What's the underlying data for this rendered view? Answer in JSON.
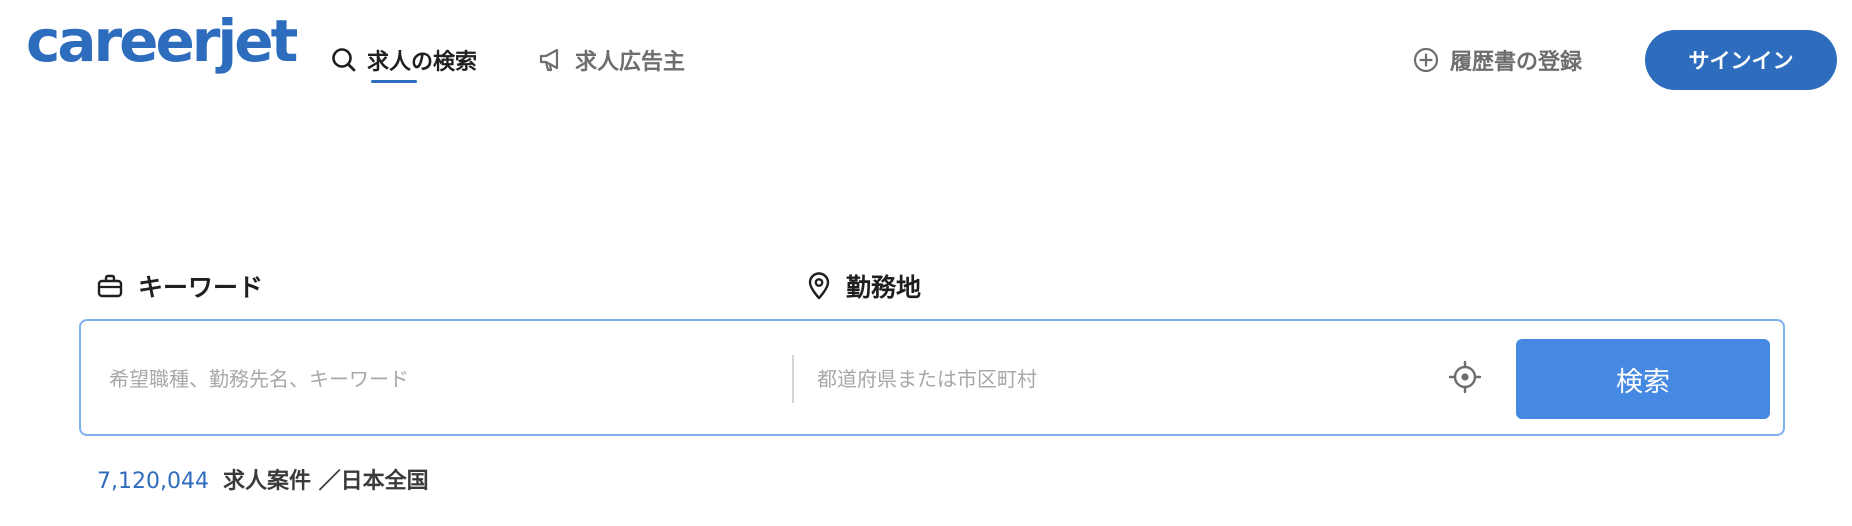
{
  "header": {
    "logo_text": "careerjet",
    "nav": {
      "search_jobs": "求人の検索",
      "employers": "求人広告主",
      "register_resume": "履歴書の登録"
    },
    "signin_label": "サインイン"
  },
  "search": {
    "keyword_label": "キーワード",
    "keyword_placeholder": "希望職種、勤務先名、キーワード",
    "keyword_value": "",
    "location_label": "勤務地",
    "location_placeholder": "都道府県または市区町村",
    "location_value": "",
    "search_button_label": "検索"
  },
  "stats": {
    "job_count": "7,120,044",
    "job_count_text": "求人案件 ／日本全国"
  },
  "icons": {
    "search": "search-icon",
    "megaphone": "megaphone-icon",
    "plus_circle": "plus-circle-icon",
    "briefcase": "briefcase-icon",
    "location_pin": "location-pin-icon",
    "crosshair": "crosshair-icon"
  },
  "colors": {
    "brand": "#2e6cbe",
    "search_button": "#4689e2",
    "search_border": "#7fb0ea"
  }
}
